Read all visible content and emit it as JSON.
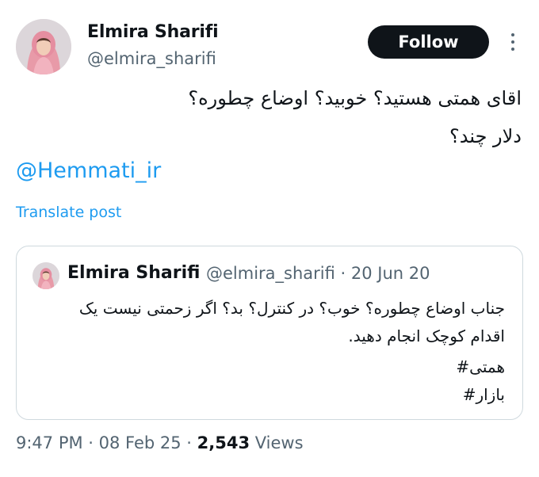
{
  "author": {
    "display_name": "Elmira Sharifi",
    "handle": "@elmira_sharifi"
  },
  "actions": {
    "follow_label": "Follow"
  },
  "tweet": {
    "line1": "اقای همتی هستید؟ خوبید؟ اوضاع چطوره؟",
    "line2": "دلار چند؟",
    "mention": "@Hemmati_ir",
    "translate_label": "Translate post"
  },
  "quoted_tweet": {
    "display_name": "Elmira Sharifi",
    "meta": "@elmira_sharifi · 20 Jun 20",
    "line1": "جناب اوضاع چطوره؟ خوب؟ در کنترل؟ بد؟ اگر زحمتی نیست یک",
    "line2": "اقدام کوچک انجام دهید.",
    "hashtag1": "همتی#",
    "hashtag2": "بازار#"
  },
  "footer": {
    "time": "9:47 PM · 08 Feb 25 · ",
    "views_count": "2,543",
    "views_label": " Views"
  },
  "icons": {
    "avatar": "profile-photo",
    "more": "vertical-ellipsis-icon"
  },
  "colors": {
    "link": "#1d9bf0",
    "button_bg": "#0f1419",
    "secondary_text": "#536471",
    "border": "#cfd9de"
  }
}
